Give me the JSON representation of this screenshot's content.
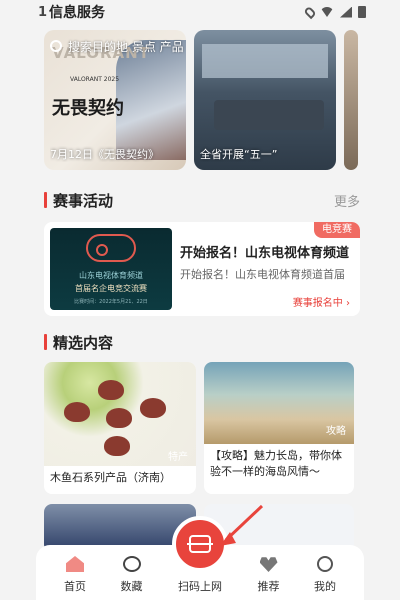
{
  "status_bar": {
    "time": "1",
    "app_title": "信息服务"
  },
  "search": {
    "placeholder": "搜索目的地 景点 产品"
  },
  "banners": [
    {
      "caption": "7月12日《无畏契约》",
      "brand": "VALORANT",
      "small": "VALORANT 2025",
      "big": "无畏契约"
    },
    {
      "caption": "全省开展“五一”"
    }
  ],
  "events_section": {
    "title": "赛事活动",
    "more": "更多"
  },
  "event_card": {
    "badge": "电竞赛",
    "title": "开始报名！山东电视体育频道",
    "desc": "开始报名！山东电视体育频道首届",
    "link": "赛事报名中 ›",
    "thumb_line1": "山东电视体育频道",
    "thumb_line2": "首届名企电竞交流赛",
    "thumb_line3": "比赛时间：2022年5月21、22日"
  },
  "featured_section": {
    "title": "精选内容"
  },
  "cards": [
    {
      "caption": "木鱼石系列产品（济南）",
      "tag": "特产"
    },
    {
      "caption": "【攻略】魅力长岛，带你体验不一样的海岛风情～",
      "tag": "攻略"
    }
  ],
  "tab_bar": {
    "items": [
      {
        "label": "首页",
        "icon": "home-icon",
        "active": true
      },
      {
        "label": "数藏",
        "icon": "collect-icon",
        "active": false
      },
      {
        "label": "扫码上网",
        "icon": "scan-icon",
        "active": false
      },
      {
        "label": "推荐",
        "icon": "heart-icon",
        "active": false
      },
      {
        "label": "我的",
        "icon": "profile-icon",
        "active": false
      }
    ]
  },
  "colors": {
    "accent": "#e8443c",
    "badge": "#f06b62",
    "muted": "#999999"
  }
}
